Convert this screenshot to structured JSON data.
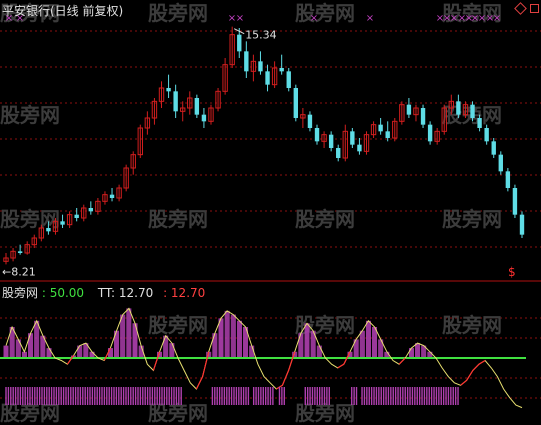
{
  "colors": {
    "background": "#000000",
    "grid": "#8b1010",
    "divider": "#b01010",
    "up": "#d21e1e",
    "down": "#5fdde6",
    "marker": "#c040c0",
    "indicator_bar": "#b040b0",
    "line_white": "#f0f0f0",
    "line_yellow": "#e8e070",
    "line_red": "#ff3030",
    "level_green": "#40e040",
    "label_white": "#e0e0e0",
    "label_green": "#40e040",
    "label_red": "#ff4040",
    "watermark": "#3c3c3c"
  },
  "header": {
    "title": "平安银行(日线 前复权)"
  },
  "indicator_header": {
    "name": "股旁网",
    "value1": ": 50.00",
    "label2": "TT: 12.70",
    "value3": ": 12.70"
  },
  "watermark_text": "股旁网",
  "chart_data": [
    {
      "type": "candlestick",
      "title": "平安银行(日线 前复权)",
      "ylim": [
        7.8,
        15.6
      ],
      "grid": true,
      "annotations": {
        "high_label": "15.34",
        "low_label": "8.21",
        "signal_mark": "$"
      },
      "candles": [
        [
          8.3,
          8.55,
          8.21,
          8.4
        ],
        [
          8.4,
          8.7,
          8.3,
          8.6
        ],
        [
          8.6,
          8.8,
          8.5,
          8.55
        ],
        [
          8.55,
          8.9,
          8.5,
          8.8
        ],
        [
          8.8,
          9.1,
          8.7,
          9.0
        ],
        [
          9.0,
          9.4,
          8.9,
          9.3
        ],
        [
          9.3,
          9.5,
          9.1,
          9.2
        ],
        [
          9.2,
          9.6,
          9.1,
          9.5
        ],
        [
          9.5,
          9.7,
          9.3,
          9.4
        ],
        [
          9.4,
          9.8,
          9.3,
          9.7
        ],
        [
          9.7,
          9.9,
          9.5,
          9.6
        ],
        [
          9.6,
          10.0,
          9.5,
          9.9
        ],
        [
          9.9,
          10.1,
          9.7,
          9.8
        ],
        [
          9.8,
          10.2,
          9.7,
          10.1
        ],
        [
          10.1,
          10.4,
          10.0,
          10.3
        ],
        [
          10.3,
          10.5,
          10.1,
          10.2
        ],
        [
          10.2,
          10.6,
          10.1,
          10.5
        ],
        [
          10.5,
          11.2,
          10.4,
          11.1
        ],
        [
          11.1,
          11.6,
          10.9,
          11.5
        ],
        [
          11.5,
          12.4,
          11.4,
          12.3
        ],
        [
          12.3,
          12.8,
          12.1,
          12.6
        ],
        [
          12.6,
          13.2,
          12.4,
          13.1
        ],
        [
          13.1,
          13.7,
          12.9,
          13.5
        ],
        [
          13.5,
          13.9,
          13.2,
          13.4
        ],
        [
          13.4,
          13.6,
          12.6,
          12.8
        ],
        [
          12.8,
          13.1,
          12.5,
          12.9
        ],
        [
          12.9,
          13.4,
          12.7,
          13.2
        ],
        [
          13.2,
          13.3,
          12.6,
          12.7
        ],
        [
          12.7,
          12.9,
          12.3,
          12.5
        ],
        [
          12.5,
          13.0,
          12.4,
          12.9
        ],
        [
          12.9,
          13.5,
          12.8,
          13.4
        ],
        [
          13.4,
          14.4,
          13.3,
          14.2
        ],
        [
          14.2,
          15.34,
          14.1,
          15.1
        ],
        [
          15.1,
          15.3,
          14.4,
          14.6
        ],
        [
          14.6,
          14.9,
          13.8,
          14.0
        ],
        [
          14.0,
          14.5,
          13.7,
          14.3
        ],
        [
          14.3,
          14.6,
          13.9,
          14.0
        ],
        [
          14.0,
          14.2,
          13.4,
          13.6
        ],
        [
          13.6,
          14.3,
          13.5,
          14.1
        ],
        [
          14.1,
          14.5,
          13.9,
          14.0
        ],
        [
          14.0,
          14.1,
          13.4,
          13.5
        ],
        [
          13.5,
          13.6,
          12.5,
          12.6
        ],
        [
          12.6,
          12.9,
          12.3,
          12.7
        ],
        [
          12.7,
          12.8,
          12.2,
          12.3
        ],
        [
          12.3,
          12.4,
          11.8,
          11.9
        ],
        [
          11.9,
          12.2,
          11.7,
          12.1
        ],
        [
          12.1,
          12.2,
          11.6,
          11.7
        ],
        [
          11.7,
          11.8,
          11.3,
          11.4
        ],
        [
          11.4,
          12.4,
          11.3,
          12.2
        ],
        [
          12.2,
          12.3,
          11.7,
          11.8
        ],
        [
          11.8,
          12.0,
          11.5,
          11.6
        ],
        [
          11.6,
          12.2,
          11.5,
          12.1
        ],
        [
          12.1,
          12.5,
          12.0,
          12.4
        ],
        [
          12.4,
          12.6,
          12.1,
          12.2
        ],
        [
          12.2,
          12.5,
          11.9,
          12.0
        ],
        [
          12.0,
          12.6,
          11.9,
          12.5
        ],
        [
          12.5,
          13.1,
          12.4,
          13.0
        ],
        [
          13.0,
          13.2,
          12.6,
          12.7
        ],
        [
          12.7,
          13.0,
          12.5,
          12.9
        ],
        [
          12.9,
          13.0,
          12.3,
          12.4
        ],
        [
          12.4,
          12.5,
          11.8,
          11.9
        ],
        [
          11.9,
          12.3,
          11.8,
          12.2
        ],
        [
          12.2,
          13.0,
          12.1,
          12.9
        ],
        [
          12.9,
          13.3,
          12.7,
          13.1
        ],
        [
          13.1,
          13.3,
          12.6,
          12.7
        ],
        [
          12.7,
          13.1,
          12.6,
          13.0
        ],
        [
          13.0,
          13.1,
          12.5,
          12.6
        ],
        [
          12.6,
          12.7,
          12.2,
          12.3
        ],
        [
          12.3,
          12.4,
          11.8,
          11.9
        ],
        [
          11.9,
          12.0,
          11.4,
          11.5
        ],
        [
          11.5,
          11.6,
          10.9,
          11.0
        ],
        [
          11.0,
          11.1,
          10.4,
          10.5
        ],
        [
          10.5,
          10.6,
          9.6,
          9.7
        ],
        [
          9.7,
          9.8,
          9.0,
          9.1
        ]
      ]
    },
    {
      "type": "bar",
      "title": "股旁网",
      "level_line": 50.0,
      "tt_value": 12.7,
      "ylim": [
        0,
        100
      ],
      "values": [
        60,
        75,
        65,
        55,
        70,
        80,
        68,
        58,
        50,
        48,
        45,
        52,
        60,
        62,
        55,
        50,
        48,
        58,
        72,
        85,
        90,
        78,
        60,
        45,
        40,
        55,
        68,
        62,
        50,
        40,
        30,
        25,
        35,
        55,
        70,
        82,
        88,
        85,
        80,
        75,
        60,
        45,
        35,
        30,
        25,
        28,
        40,
        55,
        70,
        78,
        72,
        60,
        50,
        45,
        42,
        45,
        55,
        65,
        72,
        80,
        75,
        65,
        55,
        48,
        45,
        50,
        58,
        62,
        60,
        55,
        50,
        42,
        35,
        30,
        28,
        32,
        40,
        45,
        48,
        42,
        35,
        25,
        18,
        12,
        10
      ],
      "band_blocks": [
        [
          0,
          0.34
        ],
        [
          0.4,
          0.47
        ],
        [
          0.48,
          0.52
        ],
        [
          0.53,
          0.54
        ],
        [
          0.58,
          0.63
        ],
        [
          0.67,
          0.68
        ],
        [
          0.69,
          0.88
        ]
      ]
    }
  ]
}
